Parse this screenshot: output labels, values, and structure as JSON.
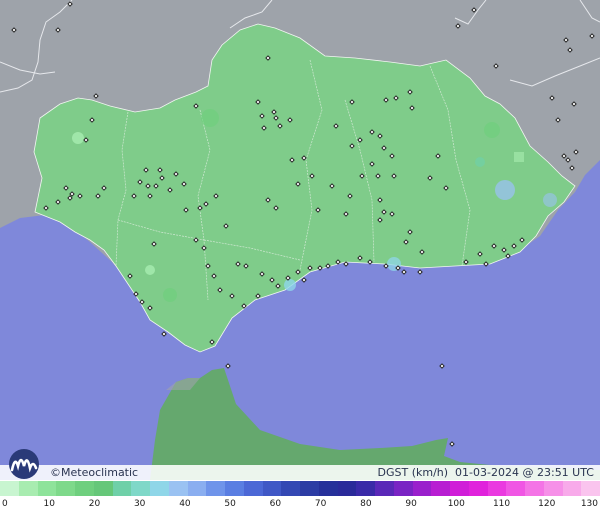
{
  "map": {
    "brand": "Meteoclimatic",
    "variable": "DGST (km/h)",
    "date": "01-03-2024",
    "at": "@",
    "time": "23:51 UTC",
    "colors": {
      "sea": "#7f88da",
      "land_outside": "#9ea3aa",
      "region": "#7fcc8a",
      "africa": "#65a86e",
      "station_marker": "#1a1a1a"
    },
    "legend": {
      "ticks": [
        "0",
        "10",
        "20",
        "30",
        "40",
        "50",
        "60",
        "70",
        "80",
        "90",
        "100",
        "110",
        "120",
        "130"
      ],
      "colors": [
        "#c8f5d0",
        "#a8ecb0",
        "#8ee39a",
        "#7ed98a",
        "#6fcf7e",
        "#66c779",
        "#6fd0a8",
        "#7fd8c8",
        "#8fd6e8",
        "#9ac2f2",
        "#8aaef0",
        "#6f94ea",
        "#5a7ee2",
        "#4c68d6",
        "#4058c6",
        "#3448b4",
        "#2c3ca4",
        "#26309a",
        "#2a2a9a",
        "#3a2aa8",
        "#5a28b8",
        "#7a24c4",
        "#9a20cc",
        "#b81ed2",
        "#d01ed8",
        "#e022dc",
        "#ea3ae0",
        "#f056e4",
        "#f474e6",
        "#f690e8",
        "#f8aaea",
        "#fac4ee"
      ]
    }
  }
}
